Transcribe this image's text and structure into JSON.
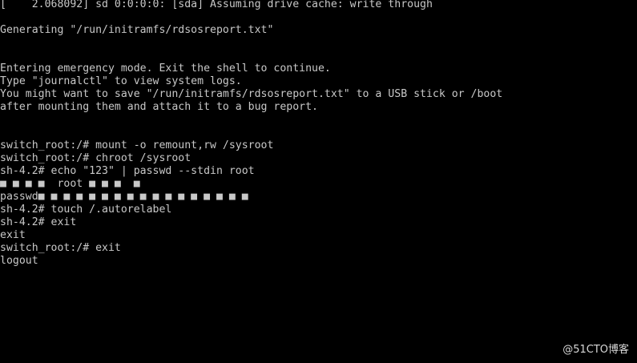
{
  "terminal": {
    "colors": {
      "background": "#000000",
      "foreground": "#c8c8c8"
    },
    "lines": [
      "[    2.068092] sd 0:0:0:0: [sda] Assuming drive cache: write through",
      "",
      "Generating \"/run/initramfs/rdsosreport.txt\"",
      "",
      "",
      "Entering emergency mode. Exit the shell to continue.",
      "Type \"journalctl\" to view system logs.",
      "You might want to save \"/run/initramfs/rdsosreport.txt\" to a USB stick or /boot",
      "after mounting them and attach it to a bug report.",
      "",
      "",
      "switch_root:/# mount -o remount,rw /sysroot",
      "switch_root:/# chroot /sysroot",
      "sh-4.2# echo \"123\" | passwd --stdin root",
      "■ ■ ■ ■  root ■ ■ ■  ■",
      "passwd■ ■ ■ ■ ■ ■ ■ ■ ■ ■ ■ ■ ■ ■ ■ ■ ■",
      "sh-4.2# touch /.autorelabel",
      "sh-4.2# exit",
      "exit",
      "switch_root:/# exit",
      "logout"
    ]
  },
  "watermark": {
    "text": "@51CTO博客"
  }
}
